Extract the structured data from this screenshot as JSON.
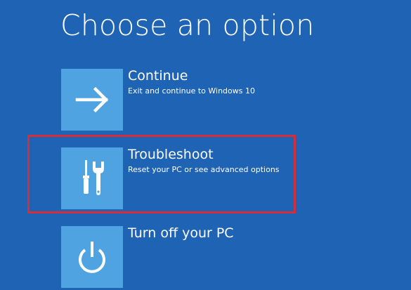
{
  "page_title": "Choose an option",
  "options": [
    {
      "title": "Continue",
      "description": "Exit and continue to Windows 10",
      "icon": "arrow-right-icon"
    },
    {
      "title": "Troubleshoot",
      "description": "Reset your PC or see advanced options",
      "icon": "tools-icon"
    },
    {
      "title": "Turn off your PC",
      "description": "",
      "icon": "power-icon"
    }
  ],
  "colors": {
    "background": "#1e63b4",
    "tile": "#4fa3e0",
    "highlight": "#d62d3b",
    "text": "#ffffff"
  }
}
